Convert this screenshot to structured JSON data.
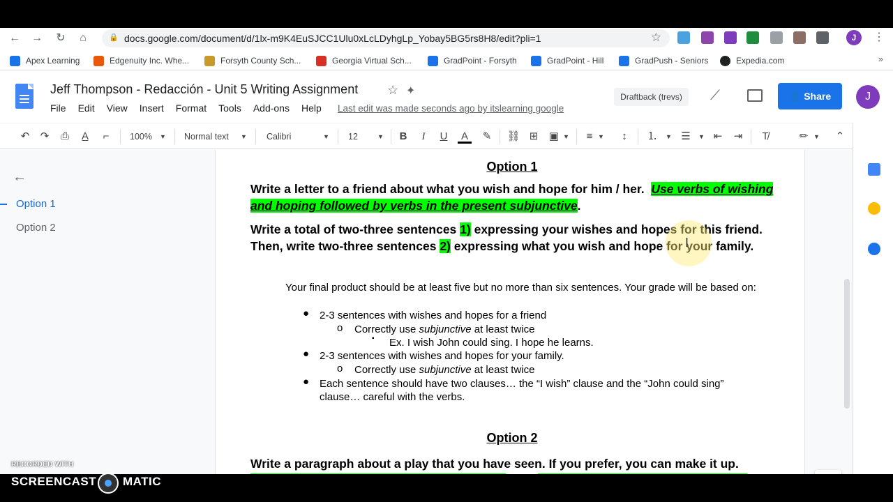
{
  "browser": {
    "url": "docs.google.com/document/d/1lx-m9K4EuSJCC1Ulu0xLcLDyhgLp_Yobay5BG5rs8H8/edit?pli=1",
    "profile_letter": "J",
    "bookmarks": [
      {
        "label": "Apex Learning",
        "color": "#1a73e8"
      },
      {
        "label": "Edgenuity Inc. Whe...",
        "color": "#e8590c"
      },
      {
        "label": "Forsyth County Sch...",
        "color": "#c79a2a"
      },
      {
        "label": "Georgia Virtual Sch...",
        "color": "#d93025"
      },
      {
        "label": "GradPoint - Forsyth",
        "color": "#1a73e8"
      },
      {
        "label": "GradPoint - Hill",
        "color": "#1a73e8"
      },
      {
        "label": "GradPush - Seniors",
        "color": "#1a73e8"
      },
      {
        "label": "Expedia.com",
        "color": "#202124"
      }
    ],
    "more_bookmarks": "»"
  },
  "docs": {
    "title": "Jeff Thompson - Redacción - Unit 5 Writing Assignment",
    "menu": [
      "File",
      "Edit",
      "View",
      "Insert",
      "Format",
      "Tools",
      "Add-ons",
      "Help"
    ],
    "last_edit": "Last edit was made seconds ago by itslearning google",
    "draftback": "Draftback (trevs)",
    "share_label": "Share",
    "avatar_letter": "J"
  },
  "toolbar": {
    "zoom": "100%",
    "style": "Normal text",
    "font": "Calibri",
    "size": "12",
    "bold": "B",
    "italic": "I",
    "underline": "U",
    "text_color": "A"
  },
  "outline": {
    "items": [
      "Option 1",
      "Option 2"
    ],
    "active": "Option 1"
  },
  "document": {
    "option1_heading": "Option 1",
    "p1_a": "Write a letter to a friend about what you wish and hope for him / her.",
    "p1_hl": "Use verbs of wishing and hoping followed by verbs in the present subjunctive",
    "p1_end": ".",
    "p2_a": "Write a total of two-three sentences ",
    "p2_num1": "1)",
    "p2_b": " expressing your wishes and hopes for this friend. Then, write two-three sentences ",
    "p2_num2": "2)",
    "p2_c": " expressing what you wish and hope for your family.",
    "p3": "Your final product should be at least five but no more than six sentences.  Your grade will be based on:",
    "b1": "2-3 sentences with wishes and hopes for a friend",
    "b1_sub_a": "Correctly use ",
    "b1_sub_it": "subjunctive",
    "b1_sub_b": " at least twice",
    "b1_sub_sub": "Ex. I wish John could sing.  I hope he learns.",
    "b2": "2-3 sentences with wishes and hopes for your family.",
    "b2_sub_a": "Correctly use ",
    "b2_sub_it": "subjunctive",
    "b2_sub_b": " at least twice",
    "b3_line1": "Each sentence should have two clauses… the “I wish” clause and the “John could sing”",
    "b3_line2": "clause… careful with the verbs.",
    "option2_heading": "Option 2",
    "p4": "Write a paragraph about a play that you have seen. If you prefer, you can make it up."
  },
  "watermark": {
    "small": "RECORDED WITH",
    "left": "SCREENCAST",
    "right": "MATIC"
  }
}
